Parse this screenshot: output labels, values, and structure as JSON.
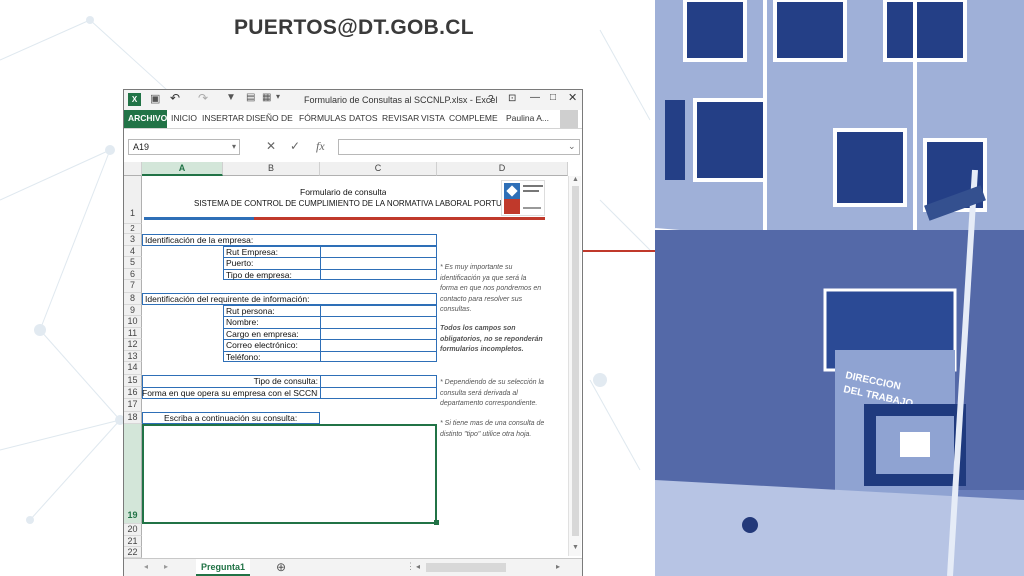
{
  "slide": {
    "email": "PUERTOS@DT.GOB.CL",
    "accent": "#c0392b"
  },
  "excel": {
    "window_title": "Formulario de Consultas al SCCNLP.xlsx - Excel",
    "help_glyph": "?",
    "user": "Paulina A...",
    "tabs": [
      "ARCHIVO",
      "INICIO",
      "INSERTAR",
      "DISEÑO DE",
      "FÓRMULAS",
      "DATOS",
      "REVISAR",
      "VISTA",
      "COMPLEME"
    ],
    "name_box": "A19",
    "fx_glyph": "fx",
    "columns": [
      "A",
      "B",
      "C",
      "D"
    ],
    "rows": [
      "1",
      "2",
      "3",
      "4",
      "5",
      "6",
      "7",
      "8",
      "9",
      "10",
      "11",
      "12",
      "13",
      "14",
      "15",
      "16",
      "17",
      "18",
      "19",
      "20",
      "21",
      "22"
    ],
    "selected_row": "19",
    "selected_column": "A",
    "sheet_tab": "Pregunta1",
    "add_sheet_glyph": "⊕",
    "brand_color": "#217346"
  },
  "form": {
    "title": "Formulario de consulta",
    "subtitle": "SISTEMA DE CONTROL DE CUMPLIMIENTO DE LA NORMATIVA LABORAL PORTUARIA",
    "section_company": "Identificación de la empresa:",
    "company_fields": [
      "Rut Empresa:",
      "Puerto:",
      "Tipo de empresa:"
    ],
    "section_requester": "Identificación del requirente de información:",
    "requester_fields": [
      "Rut persona:",
      "Nombre:",
      "Cargo en empresa:",
      "Correo electrónico:",
      "Teléfono:"
    ],
    "query_type": "Tipo de consulta:",
    "operation_form": "Forma en que opera su empresa con el SCCNLP:",
    "write_query": "Escriba a continuación su consulta:"
  },
  "notes": {
    "n1": [
      "* Es muy importante su",
      "identificación ya que será la",
      "forma en que nos pondremos en",
      "contacto para resolver sus",
      "consultas."
    ],
    "n2": [
      "Todos los campos son",
      "obligatorios, no se reponderán",
      "formularios incompletos."
    ],
    "n3": [
      "* Dependiendo de su selección la",
      "consulta será derivada al",
      "departamento correspondiente."
    ],
    "n4": [
      "* Si tiene mas de una consulta de",
      "distinto \"tipo\" utilice otra hoja."
    ]
  },
  "building": {
    "sign": [
      "DIRECCION",
      "DEL TRABAJO"
    ]
  }
}
